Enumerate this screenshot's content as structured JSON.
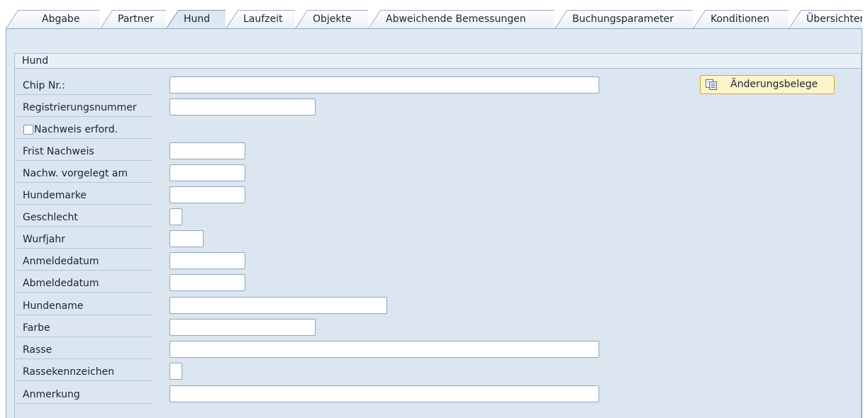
{
  "tabs": [
    {
      "label": "Abgabe",
      "active": false
    },
    {
      "label": "Partner",
      "active": false
    },
    {
      "label": "Hund",
      "active": true
    },
    {
      "label": "Laufzeit",
      "active": false
    },
    {
      "label": "Objekte",
      "active": false
    },
    {
      "label": "Abweichende Bemessungen",
      "active": false
    },
    {
      "label": "Buchungsparameter",
      "active": false
    },
    {
      "label": "Konditionen",
      "active": false
    },
    {
      "label": "Übersichten",
      "active": false
    }
  ],
  "group": {
    "title": "Hund",
    "fields": {
      "chip_nr": {
        "label": "Chip Nr.:",
        "value": ""
      },
      "registrierungsnummer": {
        "label": "Registrierungsnummer",
        "value": ""
      },
      "nachweis_erford": {
        "label": "Nachweis erford.",
        "checked": false
      },
      "frist_nachweis": {
        "label": "Frist Nachweis",
        "value": ""
      },
      "nachw_vorgelegt_am": {
        "label": "Nachw. vorgelegt am",
        "value": ""
      },
      "hundemarke": {
        "label": "Hundemarke",
        "value": ""
      },
      "geschlecht": {
        "label": "Geschlecht",
        "value": ""
      },
      "wurfjahr": {
        "label": "Wurfjahr",
        "value": ""
      },
      "anmeldedatum": {
        "label": "Anmeldedatum",
        "value": ""
      },
      "abmeldedatum": {
        "label": "Abmeldedatum",
        "value": ""
      },
      "hundename": {
        "label": "Hundename",
        "value": ""
      },
      "farbe": {
        "label": "Farbe",
        "value": ""
      },
      "rasse": {
        "label": "Rasse",
        "value": ""
      },
      "rassekennzeichen": {
        "label": "Rassekennzeichen",
        "value": ""
      },
      "anmerkung": {
        "label": "Anmerkung",
        "value": ""
      }
    }
  },
  "buttons": {
    "aenderungsbelege": {
      "label": "Änderungsbelege",
      "icon": "change-documents-icon"
    }
  },
  "colors": {
    "background": "#dfe9f4",
    "button_bg": "#fdf4c8",
    "button_border": "#d3a83b"
  }
}
